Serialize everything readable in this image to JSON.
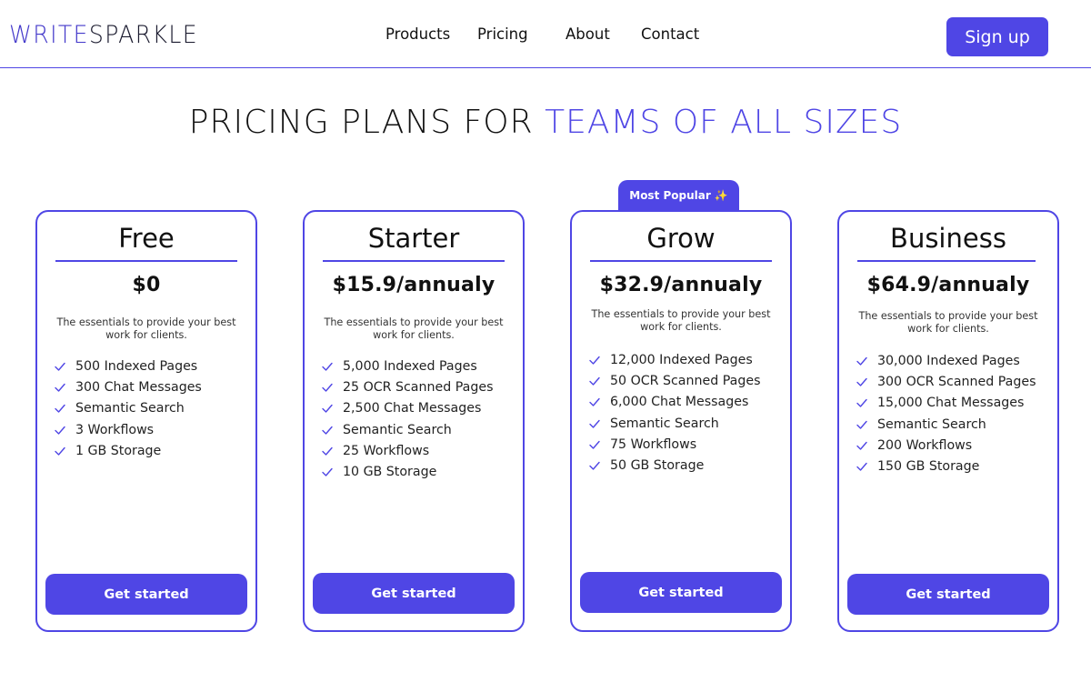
{
  "brand": {
    "logo_part1": "WRITE",
    "logo_part2": "SPARKLE"
  },
  "nav": {
    "items": [
      "Products",
      "Pricing",
      "About",
      "Contact"
    ],
    "signup_label": "Sign up"
  },
  "title": {
    "part1": "PRICING PLANS FOR ",
    "part2": "TEAMS OF ALL SIZES"
  },
  "badge": {
    "label": "Most Popular",
    "icon": "sparkle-icon",
    "emoji": "✨"
  },
  "plans": [
    {
      "name": "Free",
      "price": "$0",
      "description": "The essentials to provide your best work for clients.",
      "features": [
        "500 Indexed Pages",
        "300 Chat Messages",
        "Semantic Search",
        "3 Workflows",
        "1 GB Storage"
      ],
      "cta": "Get started"
    },
    {
      "name": "Starter",
      "price": "$15.9/annualy",
      "description": "The essentials to provide your best work for clients.",
      "features": [
        "5,000 Indexed Pages",
        "25 OCR Scanned Pages",
        "2,500 Chat Messages",
        "Semantic Search",
        "25 Workflows",
        "10 GB Storage"
      ],
      "cta": "Get started"
    },
    {
      "name": "Grow",
      "price": "$32.9/annualy",
      "description": "The essentials to provide your best work for clients.",
      "features": [
        "12,000 Indexed Pages",
        "50 OCR Scanned Pages",
        "6,000 Chat Messages",
        "Semantic Search",
        "75 Workflows",
        "50 GB Storage"
      ],
      "cta": "Get started"
    },
    {
      "name": "Business",
      "price": "$64.9/annualy",
      "description": "The essentials to provide your best work for clients.",
      "features": [
        "30,000 Indexed Pages",
        "300 OCR Scanned Pages",
        "15,000 Chat Messages",
        "Semantic Search",
        "200 Workflows",
        "150 GB Storage"
      ],
      "cta": "Get started"
    }
  ],
  "colors": {
    "accent": "#4f46e5",
    "text": "#111111"
  }
}
